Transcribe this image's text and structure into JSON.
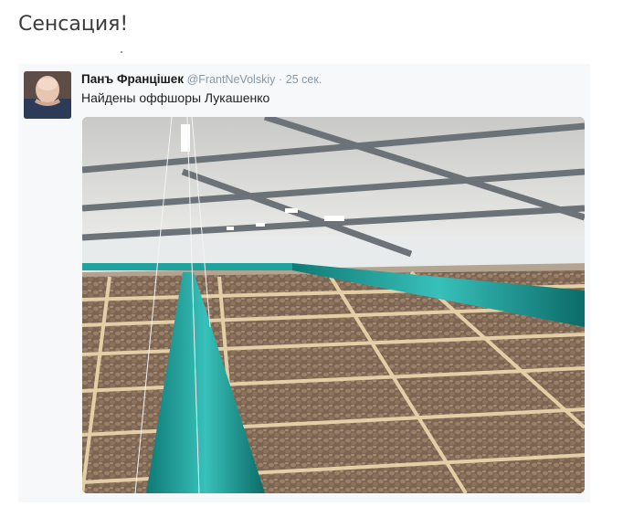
{
  "page": {
    "headline": "Сенсация!"
  },
  "tweet": {
    "author_name": "Панъ Францішек",
    "author_handle": "@FrantNeVolskiy",
    "separator": "·",
    "time": "25 сек.",
    "text": "Найдены оффшоры Лукашенко",
    "avatar_icon": "user-avatar-icon",
    "photo_icon": "warehouse-photo-icon"
  },
  "colors": {
    "handle_gray": "#8899a6",
    "card_bg": "#f6f8fa",
    "teal_duct": "#1fa6a2"
  }
}
